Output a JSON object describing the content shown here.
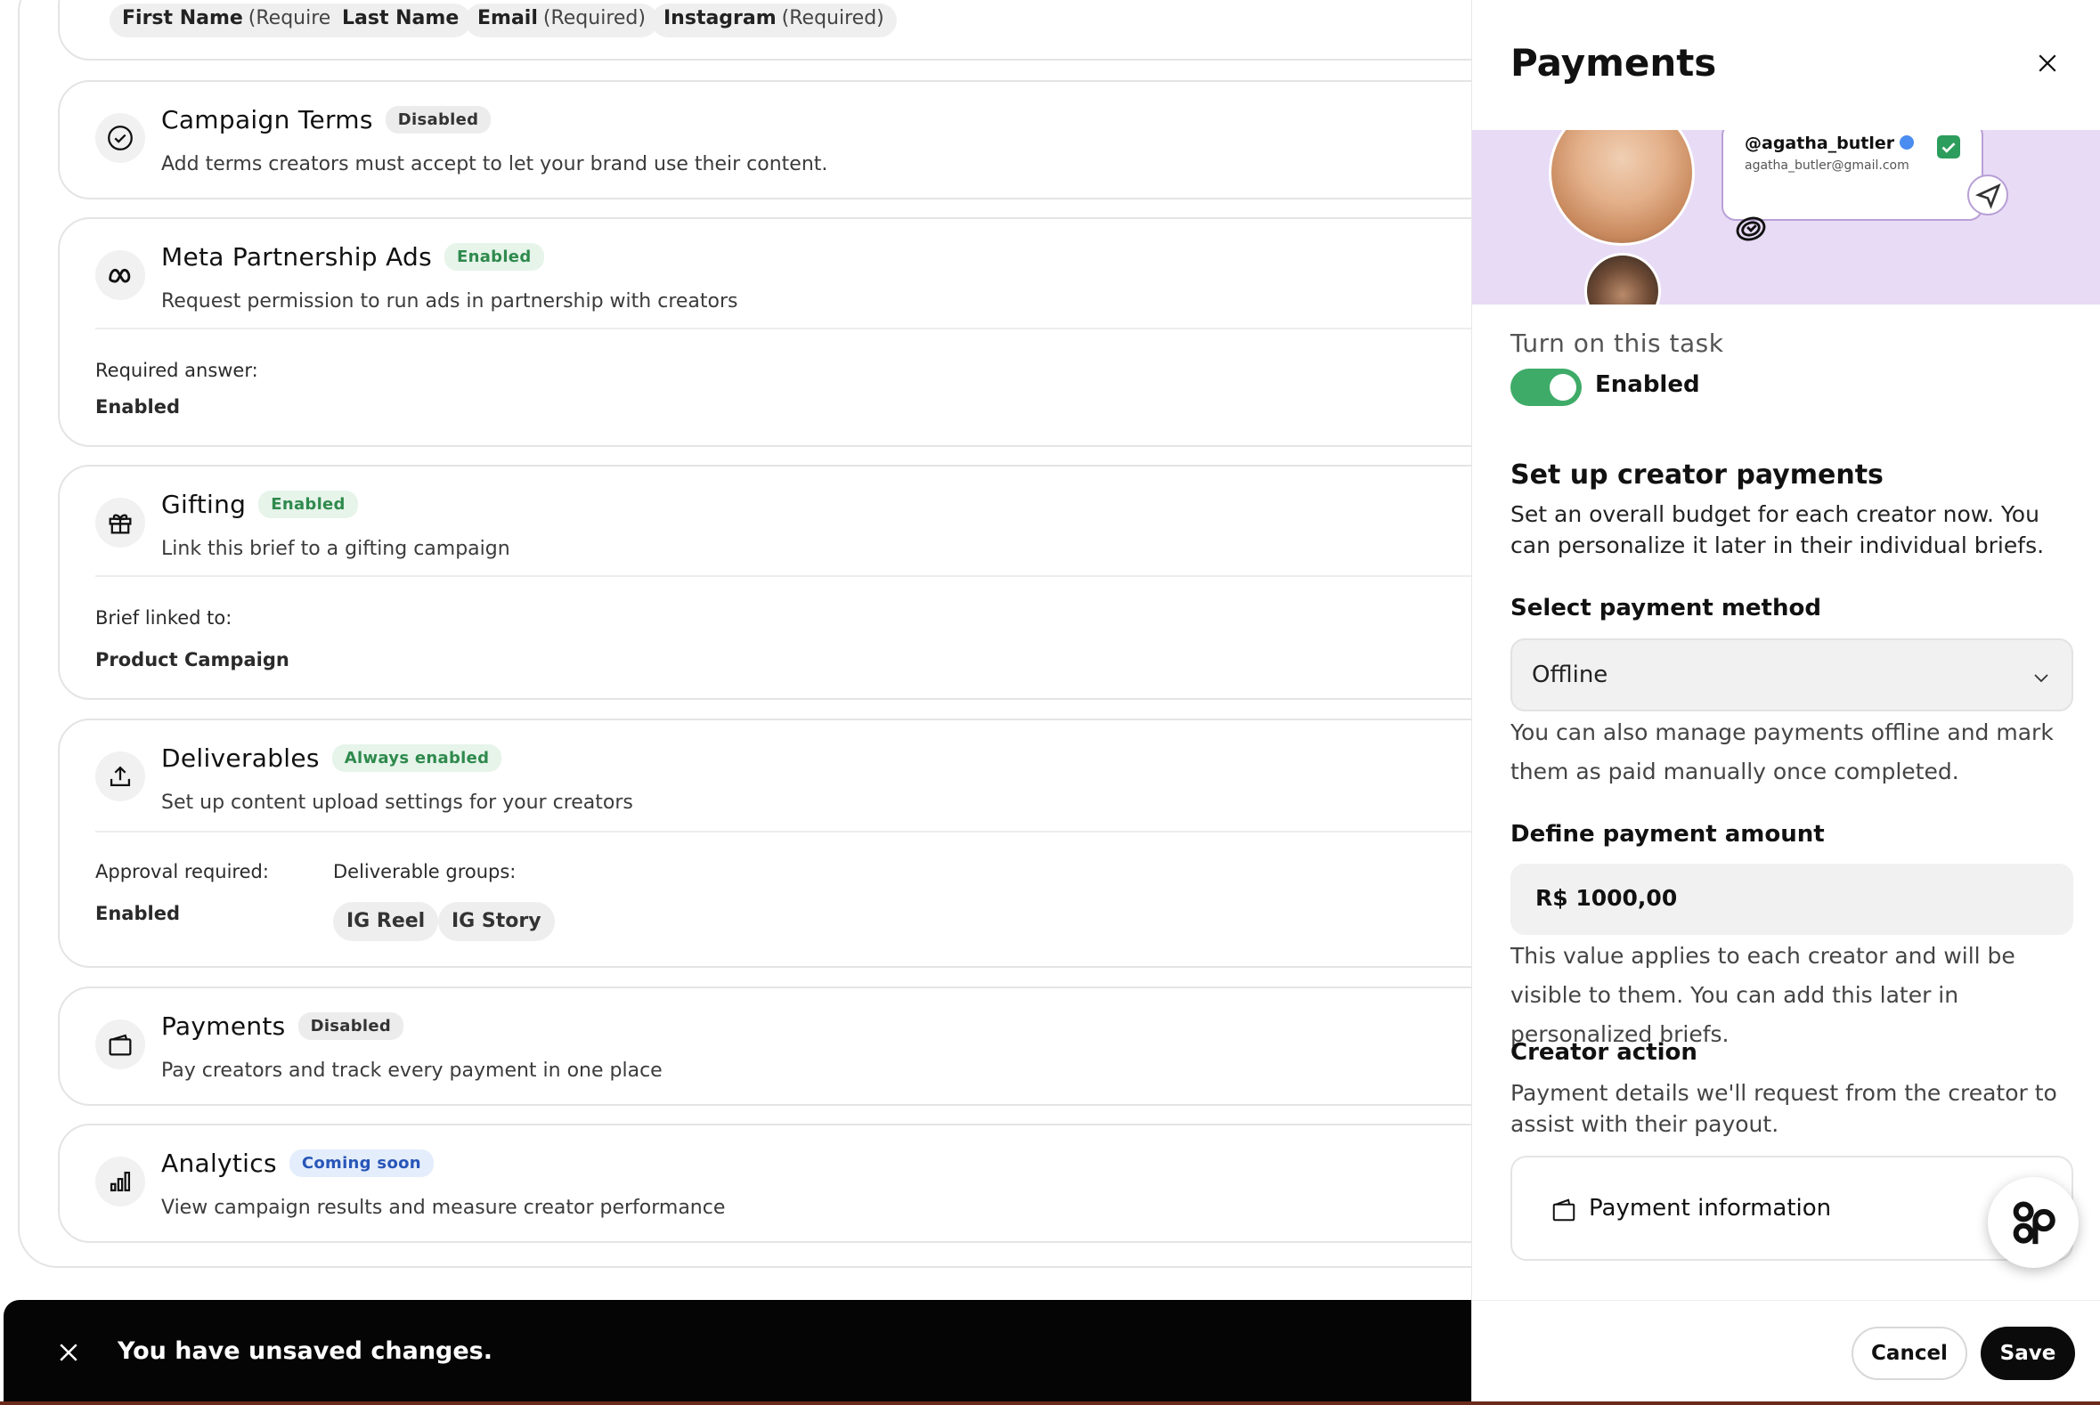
{
  "fields": [
    {
      "name": "First Name",
      "req": "(Required)"
    },
    {
      "name": "Last Name",
      "req": ""
    },
    {
      "name": "Email",
      "req": "(Required)"
    },
    {
      "name": "Instagram",
      "req": "(Required)"
    }
  ],
  "cards": {
    "terms": {
      "title": "Campaign Terms",
      "badge": "Disabled",
      "desc": "Add terms creators must accept to let your brand use their content."
    },
    "meta": {
      "title": "Meta Partnership Ads",
      "badge": "Enabled",
      "desc": "Request permission to run ads in partnership with creators",
      "req_label": "Required answer:",
      "req_value": "Enabled"
    },
    "gifting": {
      "title": "Gifting",
      "badge": "Enabled",
      "desc": "Link this brief to a gifting campaign",
      "linked_label": "Brief linked to:",
      "linked_value": "Product Campaign"
    },
    "deliverables": {
      "title": "Deliverables",
      "badge": "Always enabled",
      "desc": "Set up content upload settings for your creators",
      "approval_label": "Approval required:",
      "approval_value": "Enabled",
      "groups_label": "Deliverable groups:",
      "groups": [
        "IG Reel",
        "IG Story"
      ]
    },
    "payments": {
      "title": "Payments",
      "badge": "Disabled",
      "desc": "Pay creators and track every payment in one place"
    },
    "analytics": {
      "title": "Analytics",
      "badge": "Coming soon",
      "desc": "View campaign results and measure creator performance"
    }
  },
  "snackbar": {
    "message": "You have unsaved changes."
  },
  "panel": {
    "title": "Payments",
    "hero": {
      "username": "@agatha_butler",
      "email": "agatha_butler@gmail.com"
    },
    "task_label": "Turn on this task",
    "toggle_label": "Enabled",
    "toggle_on": true,
    "setup_heading": "Set up creator payments",
    "setup_text": "Set an overall budget for each creator now. You can personalize it later in their individual briefs.",
    "method_label": "Select payment method",
    "method_value": "Offline",
    "method_help": "You can also manage payments offline and mark them as paid manually once completed.",
    "amount_label": "Define payment amount",
    "amount_value": "R$ 1000,00",
    "amount_help": "This value applies to each creator and will be visible to them. You can add this later in personalized briefs.",
    "creator_action_label": "Creator action",
    "creator_action_text": "Payment details we'll request from the creator to assist with their payout.",
    "payment_info_label": "Payment information",
    "cancel_label": "Cancel",
    "save_label": "Save"
  },
  "colors": {
    "accent_green": "#3fab68",
    "hero_bg": "#e8dbf6",
    "snackbar_bg": "#050505"
  }
}
